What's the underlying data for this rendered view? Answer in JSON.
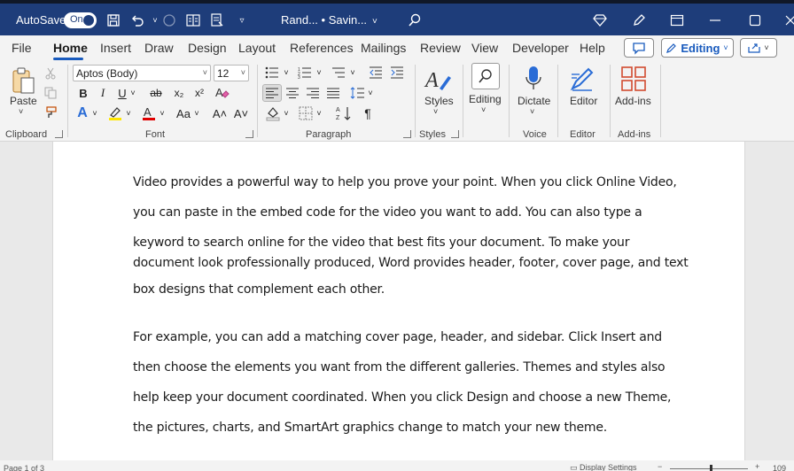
{
  "titlebar": {
    "autosave_label": "AutoSave",
    "autosave_state": "On",
    "doc_title": "Rand... • Savin...",
    "icons": [
      "save-icon",
      "undo-icon",
      "redo-icon",
      "layout-icon",
      "doc-icon",
      "customize-icon",
      "search-icon",
      "diamond-icon",
      "pen-icon",
      "restore-icon",
      "minimize-icon",
      "maximize-icon",
      "close-icon"
    ]
  },
  "tabs": [
    "File",
    "Home",
    "Insert",
    "Draw",
    "Design",
    "Layout",
    "References",
    "Mailings",
    "Review",
    "View",
    "Developer",
    "Help"
  ],
  "tab_right": {
    "editing_label": "Editing"
  },
  "ribbon": {
    "clipboard": {
      "paste_label": "Paste",
      "group_label": "Clipboard"
    },
    "font": {
      "font_name": "Aptos (Body)",
      "font_size": "12",
      "group_label": "Font",
      "bold": "B",
      "italic": "I",
      "underline": "U",
      "strike": "ab",
      "subscript": "x₂",
      "superscript": "x²",
      "case_label": "Aa",
      "grow": "A˄",
      "shrink": "A˅",
      "text_effects": "A",
      "highlight": "ab",
      "font_color": "A"
    },
    "paragraph": {
      "group_label": "Paragraph",
      "pilcrow": "¶"
    },
    "styles": {
      "label": "Styles",
      "group_label": "Styles"
    },
    "editing": {
      "label": "Editing"
    },
    "voice": {
      "label": "Dictate",
      "group_label": "Voice"
    },
    "editor": {
      "label": "Editor",
      "group_label": "Editor"
    },
    "addins": {
      "label": "Add-ins",
      "group_label": "Add-ins"
    }
  },
  "document": {
    "lines": [
      "Video provides a powerful way to help you prove your point. When you click Online Video,",
      "you can paste in the embed code for the video you want to add. You can also type a",
      "keyword to search online for the video that best fits your document. To make your",
      "document look professionally produced, Word provides header, footer, cover page, and text",
      "box designs that complement each other.",
      "For example, you can add a matching cover page, header, and sidebar. Click Insert and",
      "then choose the elements you want from the different galleries. Themes and styles also",
      "help keep your document coordinated. When you click Design and choose a new Theme,",
      "the pictures, charts, and SmartArt graphics change to match your new theme."
    ]
  },
  "status": {
    "page": "Page 1 of 3",
    "display": "Display Settings",
    "zoom": "109"
  },
  "colors": {
    "titlebar": "#1e3d7a",
    "accent": "#185abd"
  }
}
